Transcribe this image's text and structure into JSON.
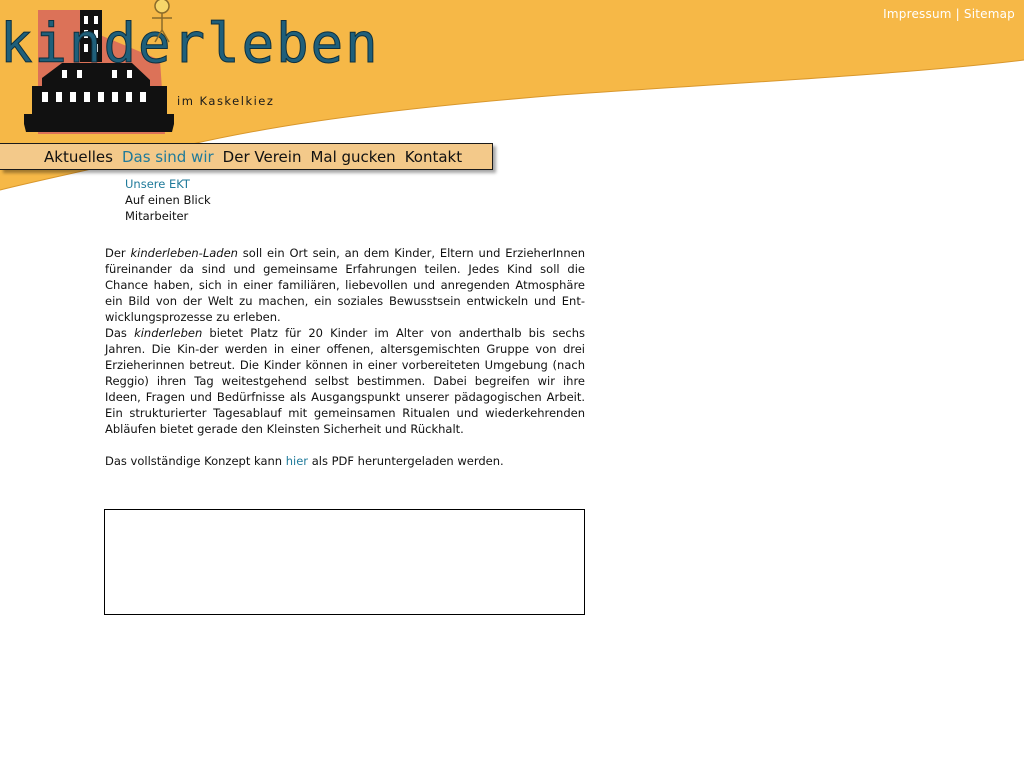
{
  "site": {
    "logo_text": "kinderleben",
    "logo_subtitle": "im Kaskelkiez",
    "colors": {
      "header_orange": "#f6b847",
      "nav_bg": "#f3c98a",
      "link": "#1f7a9a",
      "house_red": "#d96a5a"
    }
  },
  "top_links": {
    "impressum": "Impressum",
    "separator": "|",
    "sitemap": "Sitemap"
  },
  "nav": {
    "items": [
      {
        "label": "Aktuelles",
        "active": false
      },
      {
        "label": "Das sind wir",
        "active": true
      },
      {
        "label": "Der Verein",
        "active": false
      },
      {
        "label": "Mal gucken",
        "active": false
      },
      {
        "label": "Kontakt",
        "active": false
      }
    ]
  },
  "subnav": {
    "items": [
      {
        "label": "Unsere EKT",
        "active": true
      },
      {
        "label": "Auf einen Blick",
        "active": false
      },
      {
        "label": "Mitarbeiter",
        "active": false
      }
    ]
  },
  "content": {
    "p1_prefix": "Der ",
    "p1_em": "kinderleben-Laden",
    "p1_rest": " soll ein Ort sein, an dem Kinder, Eltern und ErzieherInnen füreinander da sind und gemeinsame Erfahrungen teilen. Jedes Kind soll die Chance haben, sich in einer familiären, liebevollen und anregenden Atmosphäre ein Bild von der Welt zu machen, ein soziales Bewusstsein entwickeln und Ent-wicklungsprozesse zu erleben.",
    "p2_prefix": "Das ",
    "p2_em": "kinderleben",
    "p2_rest": " bietet Platz für 20 Kinder im Alter von anderthalb bis sechs Jahren. Die Kin-der werden in einer offenen, altersgemischten Gruppe von drei Erzieherinnen betreut. Die Kinder können in einer vorbereiteten Umgebung (nach Reggio) ihren Tag weitestgehend selbst bestimmen. Dabei begreifen wir ihre Ideen, Fragen und Bedürfnisse als Ausgangspunkt unserer pädagogischen Arbeit. Ein strukturierter Tagesablauf mit gemeinsamen Ritualen und wiederkehrenden Abläufen bietet gerade den Kleinsten Sicherheit und Rückhalt.",
    "p3_prefix": "Das vollständige Konzept kann ",
    "p3_link": "hier",
    "p3_suffix": " als PDF heruntergeladen werden."
  }
}
